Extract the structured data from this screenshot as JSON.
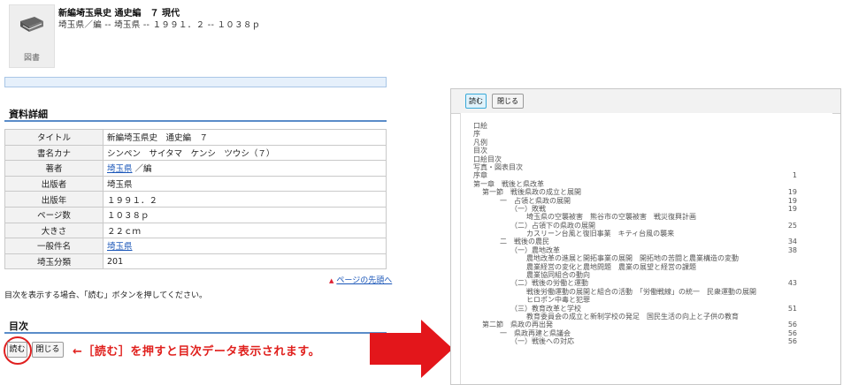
{
  "record": {
    "title": "新編埼玉県史 通史編　７ 現代",
    "subtitle": "埼玉県／編 -- 埼玉県 -- １９９１．２ -- １０３８ｐ",
    "icon_label": "図書"
  },
  "detail": {
    "heading": "資料詳細",
    "rows": [
      {
        "label": "タイトル",
        "value": "新編埼玉県史　通史編　７"
      },
      {
        "label": "書名カナ",
        "value": "シンペン　サイタマ　ケンシ　ツウシ（７）"
      },
      {
        "label": "著者",
        "value": "埼玉県",
        "suffix": "／編"
      },
      {
        "label": "出版者",
        "value": "埼玉県"
      },
      {
        "label": "出版年",
        "value": "１９９１．２"
      },
      {
        "label": "ページ数",
        "value": "１０３８ｐ"
      },
      {
        "label": "大きさ",
        "value": "２２ｃｍ"
      },
      {
        "label": "一般件名",
        "value": "埼玉県"
      },
      {
        "label": "埼玉分類",
        "value": "201"
      }
    ]
  },
  "page_top": "ページの先頭へ",
  "instruction": "目次を表示する場合、「読む」ボタンを押してください。",
  "toc": {
    "heading": "目次",
    "read_button": "読む",
    "close_button": "閉じる"
  },
  "annotation": "←［読む］を押すと目次データ表示されます。",
  "colors": {
    "accent_red": "#e0201d",
    "link_blue": "#1a56b8",
    "rule_blue": "#5a8cc9"
  },
  "viewer": {
    "read_button": "読む",
    "close_button": "閉じる",
    "entries": [
      {
        "text": "口絵",
        "indent": 0
      },
      {
        "text": "序",
        "indent": 0
      },
      {
        "text": "凡例",
        "indent": 0
      },
      {
        "text": "目次",
        "indent": 0
      },
      {
        "text": "口絵目次",
        "indent": 0
      },
      {
        "text": "写真・図表目次",
        "indent": 0
      },
      {
        "text": "序章",
        "indent": 0,
        "page": "1"
      },
      {
        "text": "第一章　戦後と県改革",
        "indent": 0
      },
      {
        "text": "第一節　戦後県政の成立と展開",
        "indent": 1,
        "page": "19"
      },
      {
        "text": "一　占領と県政の展開",
        "indent": 2,
        "page": "19"
      },
      {
        "text": "（一）敗戦",
        "indent": 3,
        "page": "19"
      },
      {
        "text": "埼玉県の空襲被害　熊谷市の空襲被害　戦災復興計画",
        "indent": 4
      },
      {
        "text": "（二）占領下の県政の展開",
        "indent": 3,
        "page": "25"
      },
      {
        "text": "カスリーン台風と復旧事業　キティ台風の襲来",
        "indent": 4
      },
      {
        "text": "二　戦後の農民",
        "indent": 2,
        "page": "34"
      },
      {
        "text": "（一）農地改革",
        "indent": 3,
        "page": "38"
      },
      {
        "text": "農地改革の進展と開拓事業の展開　開拓地の苦闘と農業構造の変動",
        "indent": 4
      },
      {
        "text": "農業経営の変化と農地問題　農業の展望と経営の課題",
        "indent": 4
      },
      {
        "text": "農業協同組合の動向",
        "indent": 4
      },
      {
        "text": "（二）戦後の労働と運動",
        "indent": 3,
        "page": "43"
      },
      {
        "text": "戦後労働運動の展開と組合の活動　「労働戦線」の統一　民衆運動の展開",
        "indent": 4
      },
      {
        "text": "ヒロポン中毒と犯罪",
        "indent": 4
      },
      {
        "text": "（三）教育改革と学校",
        "indent": 3,
        "page": "51"
      },
      {
        "text": "教育委員会の成立と新制学校の発足　国民生活の向上と子供の教育",
        "indent": 4
      },
      {
        "text": "第二節　県政の再出発",
        "indent": 1,
        "page": "56"
      },
      {
        "text": "一　県政再建と県議会",
        "indent": 2,
        "page": "56"
      },
      {
        "text": "（一）戦後への対応",
        "indent": 3,
        "page": "56"
      }
    ]
  }
}
